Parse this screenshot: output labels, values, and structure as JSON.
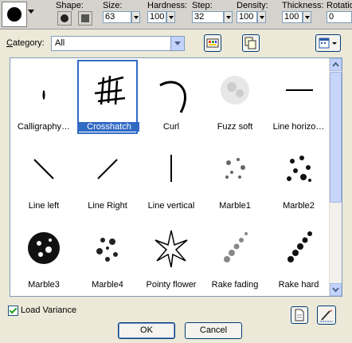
{
  "toolbar": {
    "shape_label": "Shape:",
    "size_label": "Size:",
    "size_value": "63",
    "hardness_label": "Hardness:",
    "hardness_value": "100",
    "step_label": "Step:",
    "step_value": "32",
    "density_label": "Density:",
    "density_value": "100",
    "thickness_label": "Thickness:",
    "thickness_value": "100",
    "rotation_label": "Rotation",
    "rotation_value": "0"
  },
  "dialog": {
    "category_label_u": "C",
    "category_label_rest": "ategory:",
    "category_value": "All",
    "brushes": [
      "Calligraphy…",
      "Crosshatch",
      "Curl",
      "Fuzz soft",
      "Line horizo…",
      "Line left",
      "Line Right",
      "Line vertical",
      "Marble1",
      "Marble2",
      "Marble3",
      "Marble4",
      "Pointy flower",
      "Rake fading",
      "Rake hard"
    ],
    "selected_brush": "Crosshatch",
    "load_variance_label": "Load Variance",
    "load_variance_checked": true,
    "ok_label": "OK",
    "cancel_label": "Cancel"
  },
  "colors": {
    "selection": "#316ac5",
    "dialog_bg": "#ece9d8",
    "border": "#7f9db9"
  }
}
